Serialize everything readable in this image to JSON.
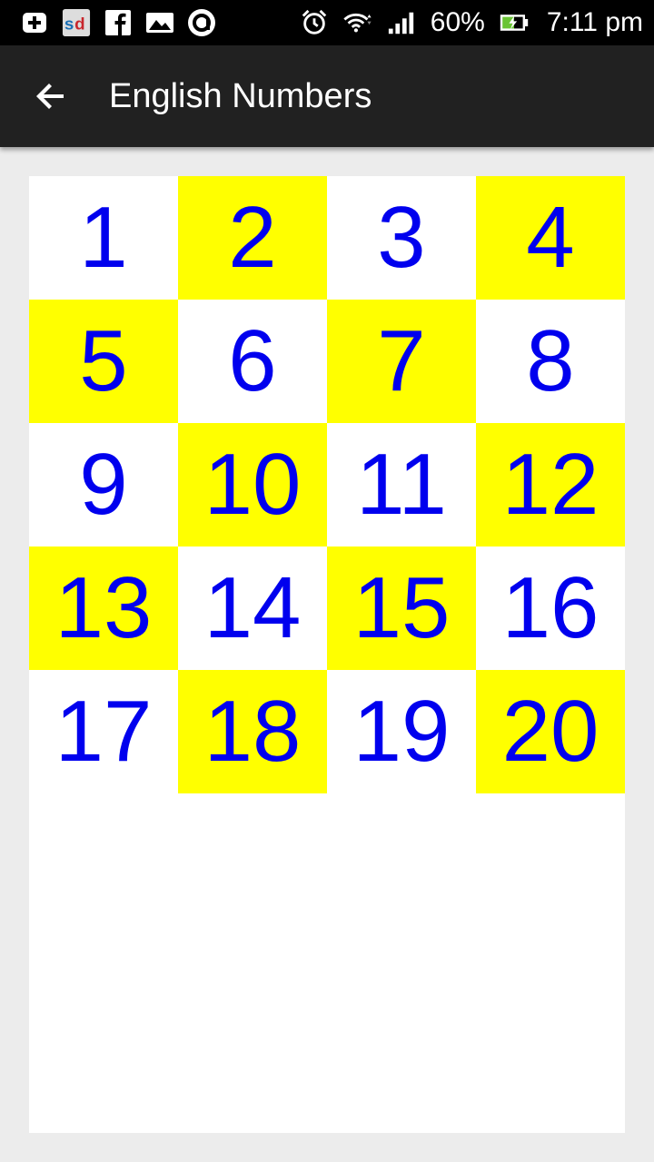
{
  "status_bar": {
    "battery_percent": "60%",
    "time": "7:11 pm",
    "left_icons": [
      "plus-box-icon",
      "sd-app-icon",
      "facebook-icon",
      "photos-icon",
      "circle-a-icon"
    ],
    "right_icons": [
      "alarm-icon",
      "wifi-icon",
      "signal-icon",
      "battery-charging-icon"
    ]
  },
  "app_bar": {
    "title": "English Numbers",
    "back_icon": "arrow-back-icon"
  },
  "colors": {
    "number_text": "#0000ee",
    "highlight": "#ffff00",
    "plain": "#ffffff",
    "app_bar": "#212121",
    "background": "#ececec"
  },
  "numbers": [
    {
      "label": "1",
      "bg": "white"
    },
    {
      "label": "2",
      "bg": "yellow"
    },
    {
      "label": "3",
      "bg": "white"
    },
    {
      "label": "4",
      "bg": "yellow"
    },
    {
      "label": "5",
      "bg": "yellow"
    },
    {
      "label": "6",
      "bg": "white"
    },
    {
      "label": "7",
      "bg": "yellow"
    },
    {
      "label": "8",
      "bg": "white"
    },
    {
      "label": "9",
      "bg": "white"
    },
    {
      "label": "10",
      "bg": "yellow"
    },
    {
      "label": "11",
      "bg": "white"
    },
    {
      "label": "12",
      "bg": "yellow"
    },
    {
      "label": "13",
      "bg": "yellow"
    },
    {
      "label": "14",
      "bg": "white"
    },
    {
      "label": "15",
      "bg": "yellow"
    },
    {
      "label": "16",
      "bg": "white"
    },
    {
      "label": "17",
      "bg": "white"
    },
    {
      "label": "18",
      "bg": "yellow"
    },
    {
      "label": "19",
      "bg": "white"
    },
    {
      "label": "20",
      "bg": "yellow"
    }
  ]
}
